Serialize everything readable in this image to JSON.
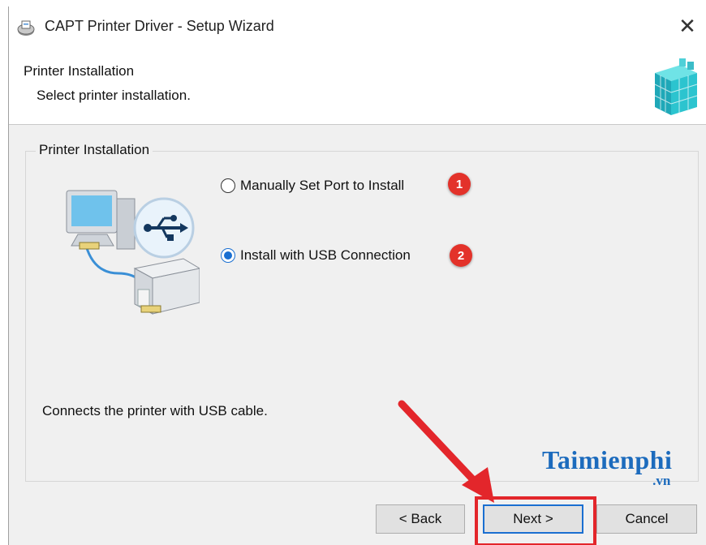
{
  "window": {
    "title": "CAPT Printer Driver - Setup Wizard",
    "close_glyph": "✕"
  },
  "header": {
    "title": "Printer Installation",
    "subtitle": "Select printer installation."
  },
  "group": {
    "label": "Printer Installation",
    "options": [
      {
        "label": "Manually Set Port to Install",
        "checked": false,
        "badge": "1"
      },
      {
        "label": "Install with USB Connection",
        "checked": true,
        "badge": "2"
      }
    ],
    "description": "Connects the printer with USB cable."
  },
  "watermark": {
    "main": "Taimienphi",
    "sub": ".vn"
  },
  "buttons": {
    "back": "< Back",
    "next": "Next >",
    "cancel": "Cancel"
  },
  "colors": {
    "accent": "#1a6fd1",
    "annotation_red": "#e3262b",
    "watermark": "#1c6bbd"
  },
  "icons": [
    "printer-driver-icon",
    "close-icon",
    "cube-icon",
    "usb-icon",
    "computer-icon",
    "printer-icon",
    "radio-unchecked",
    "radio-checked"
  ]
}
